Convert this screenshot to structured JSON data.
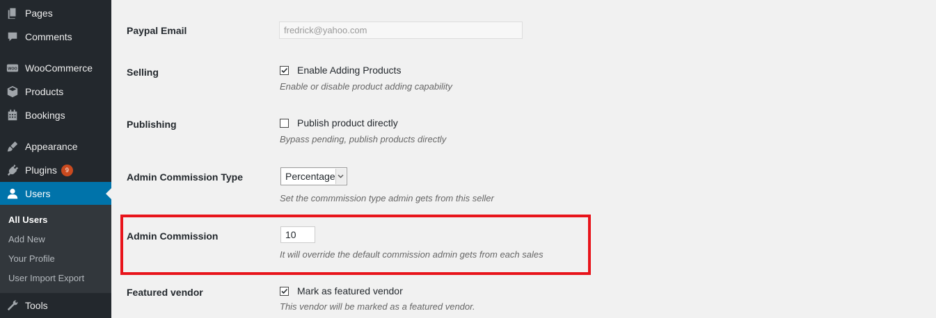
{
  "sidebar": {
    "items": [
      {
        "label": "Pages",
        "icon": "pages-icon"
      },
      {
        "label": "Comments",
        "icon": "comments-icon"
      },
      {
        "label": "WooCommerce",
        "icon": "woocommerce-icon",
        "icon_text": "WOO"
      },
      {
        "label": "Products",
        "icon": "products-icon"
      },
      {
        "label": "Bookings",
        "icon": "calendar-icon"
      },
      {
        "label": "Appearance",
        "icon": "brush-icon"
      },
      {
        "label": "Plugins",
        "icon": "plugin-icon",
        "badge": "9"
      },
      {
        "label": "Users",
        "icon": "user-icon",
        "active": true
      },
      {
        "label": "Tools",
        "icon": "wrench-icon"
      }
    ],
    "submenu": [
      "All Users",
      "Add New",
      "Your Profile",
      "User Import Export"
    ]
  },
  "form": {
    "paypal": {
      "label": "Paypal Email",
      "value": "fredrick@yahoo.com"
    },
    "selling": {
      "label": "Selling",
      "checkbox_label": "Enable Adding Products",
      "checked": true,
      "description": "Enable or disable product adding capability"
    },
    "publishing": {
      "label": "Publishing",
      "checkbox_label": "Publish product directly",
      "checked": false,
      "description": "Bypass pending, publish products directly"
    },
    "commission_type": {
      "label": "Admin Commission Type",
      "selected": "Percentage",
      "description": "Set the commmission type admin gets from this seller"
    },
    "commission": {
      "label": "Admin Commission",
      "value": "10",
      "description": "It will override the default commission admin gets from each sales"
    },
    "featured": {
      "label": "Featured vendor",
      "checkbox_label": "Mark as featured vendor",
      "checked": true,
      "description": "This vendor will be marked as a featured vendor."
    }
  },
  "colors": {
    "sidebar_bg": "#23282d",
    "active_item": "#0073aa",
    "badge": "#ca4a1f",
    "highlight_border": "#e8141b"
  }
}
